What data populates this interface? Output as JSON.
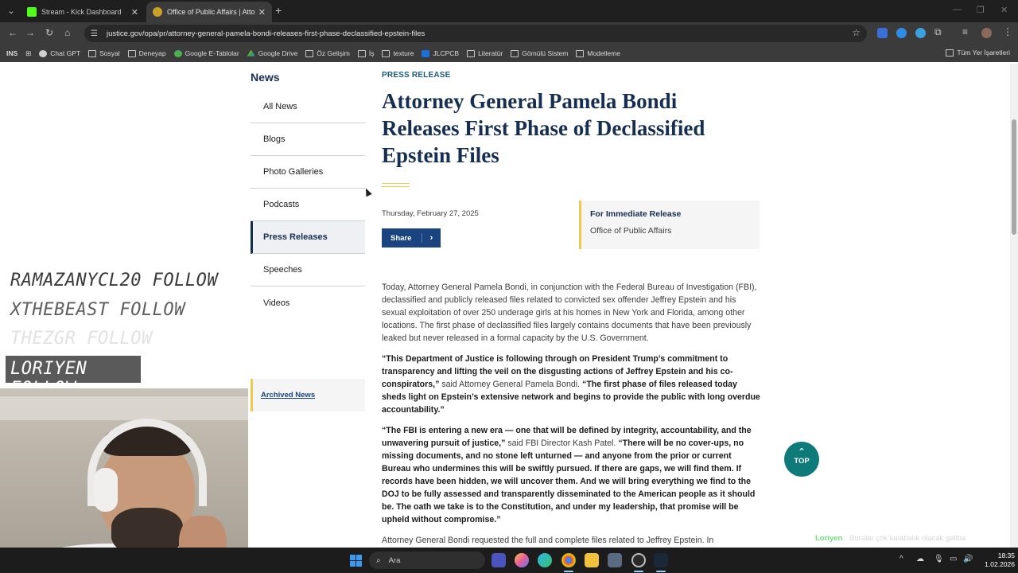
{
  "browser": {
    "tabs": [
      {
        "title": "Stream - Kick Dashboard",
        "favicon_color": "#53fc18"
      },
      {
        "title": "Office of Public Affairs | Attorne",
        "favicon_color": "#c9a227"
      }
    ],
    "url": "justice.gov/opa/pr/attorney-general-pamela-bondi-releases-first-phase-declassified-epstein-files",
    "bookmarks": [
      "INS",
      "Chat GPT",
      "Sosyal",
      "Deneyap",
      "Google E-Tablolar",
      "Google Drive",
      "Öz Gelişim",
      "İş",
      "texture",
      "JLCPCB",
      "Literatür",
      "Gömülü Sistem",
      "Modelleme"
    ],
    "all_bookmarks": "Tüm Yer İşaretleri"
  },
  "sidenav": {
    "title": "News",
    "items": [
      "All News",
      "Blogs",
      "Photo Galleries",
      "Podcasts",
      "Press Releases",
      "Speeches",
      "Videos"
    ],
    "active": "Press Releases",
    "archived": "Archived News"
  },
  "article": {
    "kicker": "PRESS RELEASE",
    "headline": "Attorney General Pamela Bondi Releases First Phase of Declassified Epstein Files",
    "date": "Thursday, February 27, 2025",
    "share": "Share",
    "release_label": "For Immediate Release",
    "office": "Office of Public Affairs",
    "p1": "Today, Attorney General Pamela Bondi, in conjunction with the Federal Bureau of Investigation (FBI), declassified and publicly released files related to convicted sex offender Jeffrey Epstein and his sexual exploitation of over 250 underage girls at his homes in New York and Florida, among other locations. The first phase of declassified files largely contains documents that have been previously leaked but never released in a formal capacity by the U.S. Government.",
    "p2_q1": "“This Department of Justice is following through on President Trump’s commitment to transparency and lifting the veil on the disgusting actions of Jeffrey Epstein and his co-conspirators,”",
    "p2_said": " said Attorney General Pamela Bondi. ",
    "p2_q2": "“The first phase of files released today sheds light on Epstein’s extensive network and begins to provide the public with long overdue accountability.”",
    "p3_q1": "“The FBI is entering a new era — one that will be defined by integrity, accountability, and the unwavering pursuit of justice,”",
    "p3_said": " said FBI Director Kash Patel. ",
    "p3_q2": "“There will be no cover-ups, no missing documents, and no stone left unturned — and anyone from the prior or current Bureau who undermines this will be swiftly pursued. If there are gaps, we will find them. If records have been hidden, we will uncover them. And we will bring everything we find to the DOJ to be fully assessed and transparently disseminated to the American people as it should be. The oath we take is to the Constitution, and under my leadership, that promise will be upheld without compromise.”",
    "p4": "Attorney General Bondi requested the full and complete files related to Jeffrey Epstein. In",
    "top": "TOP"
  },
  "overlay": {
    "followers": [
      "RAMAZANYCL20 FOLLOW",
      "XTHEBEAST FOLLOW",
      "THEZGR FOLLOW",
      "LORIYEN FOLLOW"
    ],
    "chat_name": "Loriyen",
    "chat_msg": "Buralar çok kalabalık olacak galiba"
  },
  "taskbar": {
    "search": "Ara",
    "time": "18:35",
    "date": "1.02.2026"
  },
  "colors": {
    "navy": "#162e51",
    "gold": "#f2c94c",
    "share_blue": "#1a4480",
    "top_teal": "#0e7a7a"
  }
}
